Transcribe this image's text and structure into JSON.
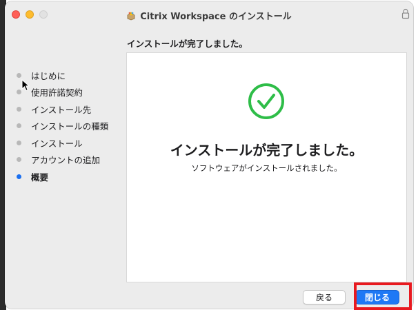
{
  "window": {
    "title": "Citrix Workspace のインストール",
    "app_icon": "citrix-installer-icon",
    "lock_icon": "lock-icon"
  },
  "header": {
    "subtitle": "インストールが完了しました。"
  },
  "sidebar": {
    "steps": [
      {
        "label": "はじめに",
        "active": false
      },
      {
        "label": "使用許諾契約",
        "active": false
      },
      {
        "label": "インストール先",
        "active": false
      },
      {
        "label": "インストールの種類",
        "active": false
      },
      {
        "label": "インストール",
        "active": false
      },
      {
        "label": "アカウントの追加",
        "active": false
      },
      {
        "label": "概要",
        "active": true
      }
    ]
  },
  "main": {
    "status_icon": "check-circle-icon",
    "title": "インストールが完了しました。",
    "message": "ソフトウェアがインストールされました。"
  },
  "footer": {
    "back_label": "戻る",
    "close_label": "閉じる"
  },
  "colors": {
    "accent": "#1e78f5",
    "success": "#2ebd48",
    "highlight": "#e8191f"
  }
}
